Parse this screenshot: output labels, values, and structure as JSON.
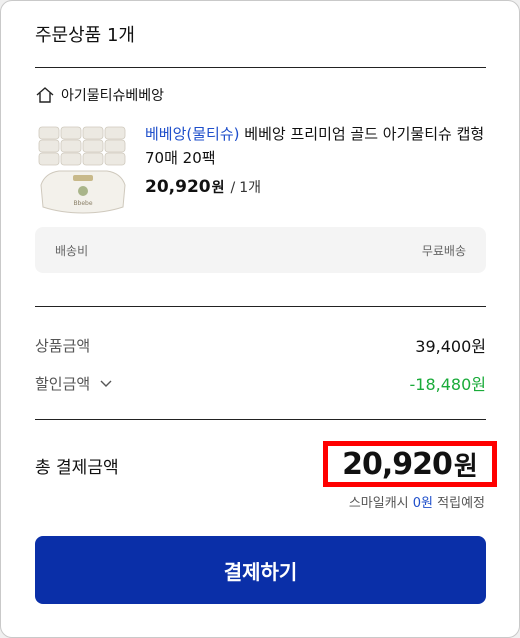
{
  "header": {
    "title": "주문상품 1개"
  },
  "store": {
    "icon": "home-icon",
    "name": "아기물티슈베베앙"
  },
  "product": {
    "brand": "베베앙(물티슈)",
    "name": "베베앙 프리미엄 골드 아기물티슈 캡형 70매 20팩",
    "price": "20,920",
    "price_unit": "원",
    "separator": "/",
    "quantity": "1개",
    "thumbnail_label": "Bbebe"
  },
  "shipping": {
    "label": "배송비",
    "value": "무료배송"
  },
  "summary": {
    "product_amount_label": "상품금액",
    "product_amount_value": "39,400원",
    "discount_label": "할인금액",
    "discount_value": "-18,480원"
  },
  "total": {
    "label": "총 결제금액",
    "amount": "20,920",
    "unit": "원"
  },
  "smile_cash": {
    "prefix": "스마일캐시",
    "amount": "0원",
    "suffix": "적립예정"
  },
  "pay_button": {
    "label": "결제하기"
  },
  "colors": {
    "accent": "#0a2fa8",
    "brand_link": "#1f4fcb",
    "discount": "#1aab3a",
    "highlight": "#ff0000"
  }
}
